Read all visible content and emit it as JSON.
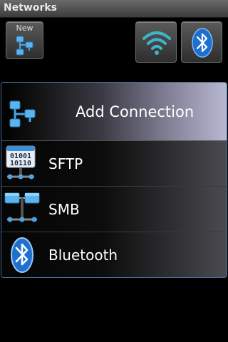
{
  "titlebar": {
    "title": "Networks"
  },
  "toolbar": {
    "new_label": "New",
    "new_icon": "network-nodes-icon",
    "wifi_icon": "wifi-icon",
    "bluetooth_icon": "bluetooth-icon"
  },
  "menu": {
    "header": {
      "label": "Add Connection",
      "icon": "network-nodes-icon"
    },
    "items": [
      {
        "label": "SFTP",
        "icon": "binary-network-icon"
      },
      {
        "label": "SMB",
        "icon": "smb-network-icon"
      },
      {
        "label": "Bluetooth",
        "icon": "bluetooth-icon"
      }
    ]
  },
  "colors": {
    "accent": "#4a6e9a",
    "icon_blue": "#4aa3e0",
    "bluetooth_blue": "#1d6fd0"
  }
}
